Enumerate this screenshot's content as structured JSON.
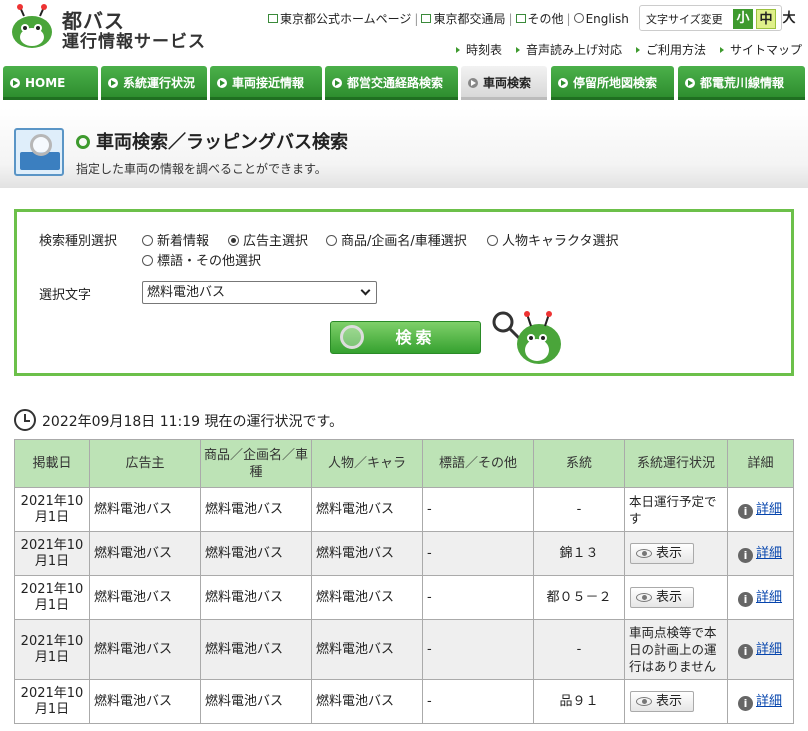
{
  "header": {
    "logo_line1": "都バス",
    "logo_line2": "運行情報サービス",
    "top_links": [
      "東京都公式ホームページ",
      "東京都交通局",
      "その他",
      "English"
    ],
    "font_size_label": "文字サイズ変更",
    "font_sizes": [
      "小",
      "中",
      "大"
    ],
    "sub_links": [
      "時刻表",
      "音声読み上げ対応",
      "ご利用方法",
      "サイトマップ"
    ]
  },
  "nav": {
    "tabs": [
      "HOME",
      "系統運行状況",
      "車両接近情報",
      "都営交通経路検索",
      "車両検索",
      "停留所地図検索",
      "都電荒川線情報"
    ],
    "active": "車両検索"
  },
  "page": {
    "title": "車両検索／ラッピングバス検索",
    "subtitle": "指定した車両の情報を調べることができます。"
  },
  "search": {
    "type_label": "検索種別選択",
    "options": [
      "新着情報",
      "広告主選択",
      "商品/企画名/車種選択",
      "人物キャラクタ選択",
      "標語・その他選択"
    ],
    "selected_option": "広告主選択",
    "text_label": "選択文字",
    "select_value": "燃料電池バス",
    "button_label": "検索"
  },
  "status": {
    "text": "2022年09月18日 11:19 現在の運行状況です。"
  },
  "table": {
    "headers": [
      "掲載日",
      "広告主",
      "商品／企画名／車種",
      "人物／キャラ",
      "標語／その他",
      "系統",
      "系統運行状況",
      "詳細"
    ],
    "show_label": "表示",
    "detail_label": "詳細",
    "rows": [
      {
        "date": "2021年10月1日",
        "advertiser": "燃料電池バス",
        "product": "燃料電池バス",
        "character": "燃料電池バス",
        "slogan": "-",
        "route": "-",
        "status": "本日運行予定です",
        "show": false
      },
      {
        "date": "2021年10月1日",
        "advertiser": "燃料電池バス",
        "product": "燃料電池バス",
        "character": "燃料電池バス",
        "slogan": "-",
        "route": "錦１３",
        "status": "",
        "show": true
      },
      {
        "date": "2021年10月1日",
        "advertiser": "燃料電池バス",
        "product": "燃料電池バス",
        "character": "燃料電池バス",
        "slogan": "-",
        "route": "都０５－２",
        "status": "",
        "show": true
      },
      {
        "date": "2021年10月1日",
        "advertiser": "燃料電池バス",
        "product": "燃料電池バス",
        "character": "燃料電池バス",
        "slogan": "-",
        "route": "-",
        "status": "車両点検等で本日の計画上の運行はありません",
        "show": false
      },
      {
        "date": "2021年10月1日",
        "advertiser": "燃料電池バス",
        "product": "燃料電池バス",
        "character": "燃料電池バス",
        "slogan": "-",
        "route": "品９１",
        "status": "",
        "show": true
      }
    ]
  },
  "colors": {
    "brand_green": "#3e9a2e",
    "panel_border": "#6cc04a",
    "table_header": "#bde3b6"
  }
}
